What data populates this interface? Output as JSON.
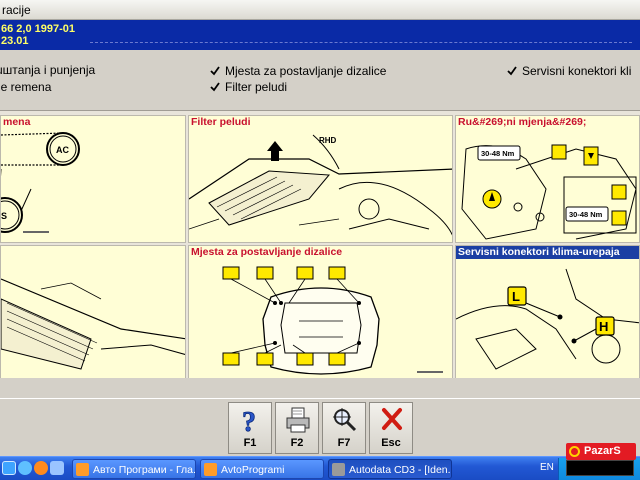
{
  "window": {
    "title_fragment": "racije"
  },
  "vehicle": {
    "line1": "66  2,0  1997-01",
    "line2": "23.01"
  },
  "checklist": [
    {
      "text": "uштanja i punjenja",
      "checked": true
    },
    {
      "text": "je remena",
      "checked": true
    },
    {
      "text": "Mjesta za postavljanje dizalice",
      "checked": true
    },
    {
      "text": "Filter peludi",
      "checked": true
    },
    {
      "text": "Servisni konektori kli",
      "checked": true
    }
  ],
  "panels": [
    {
      "title": "mena",
      "style": "red"
    },
    {
      "title": "Filter peludi",
      "style": "red",
      "caption": "RHD"
    },
    {
      "title": "Ru&#269;ni mjenja&#269;",
      "style": "red",
      "torque_1": "30-48 Nm",
      "torque_2": "30-48 Nm"
    },
    {
      "title": "",
      "style": "red"
    },
    {
      "title": "Mjesta za postavljanje dizalice",
      "style": "red"
    },
    {
      "title": "Servisni konektori klima-urepaja",
      "style": "blue",
      "marker_low": "L",
      "marker_high": "H"
    }
  ],
  "function_keys": [
    {
      "key": "F1",
      "icon": "help-question-icon"
    },
    {
      "key": "F2",
      "icon": "print-icon"
    },
    {
      "key": "F7",
      "icon": "magnifier-icon"
    },
    {
      "key": "Esc",
      "icon": "close-x-icon"
    }
  ],
  "taskbar": {
    "items": [
      {
        "label": "Авто Програми - Гла...",
        "active": false
      },
      {
        "label": "AvtoProgrami",
        "active": false
      },
      {
        "label": "Autodata CD3 - [Iden...",
        "active": true
      }
    ],
    "language": "EN"
  },
  "watermark": "PazarS",
  "colors": {
    "title_red": "#c8102e",
    "info_bar": "#0a2aa6",
    "info_text": "#ffff66",
    "panel_bg": "#fffed6",
    "blue_title": "#1b3fa3"
  }
}
